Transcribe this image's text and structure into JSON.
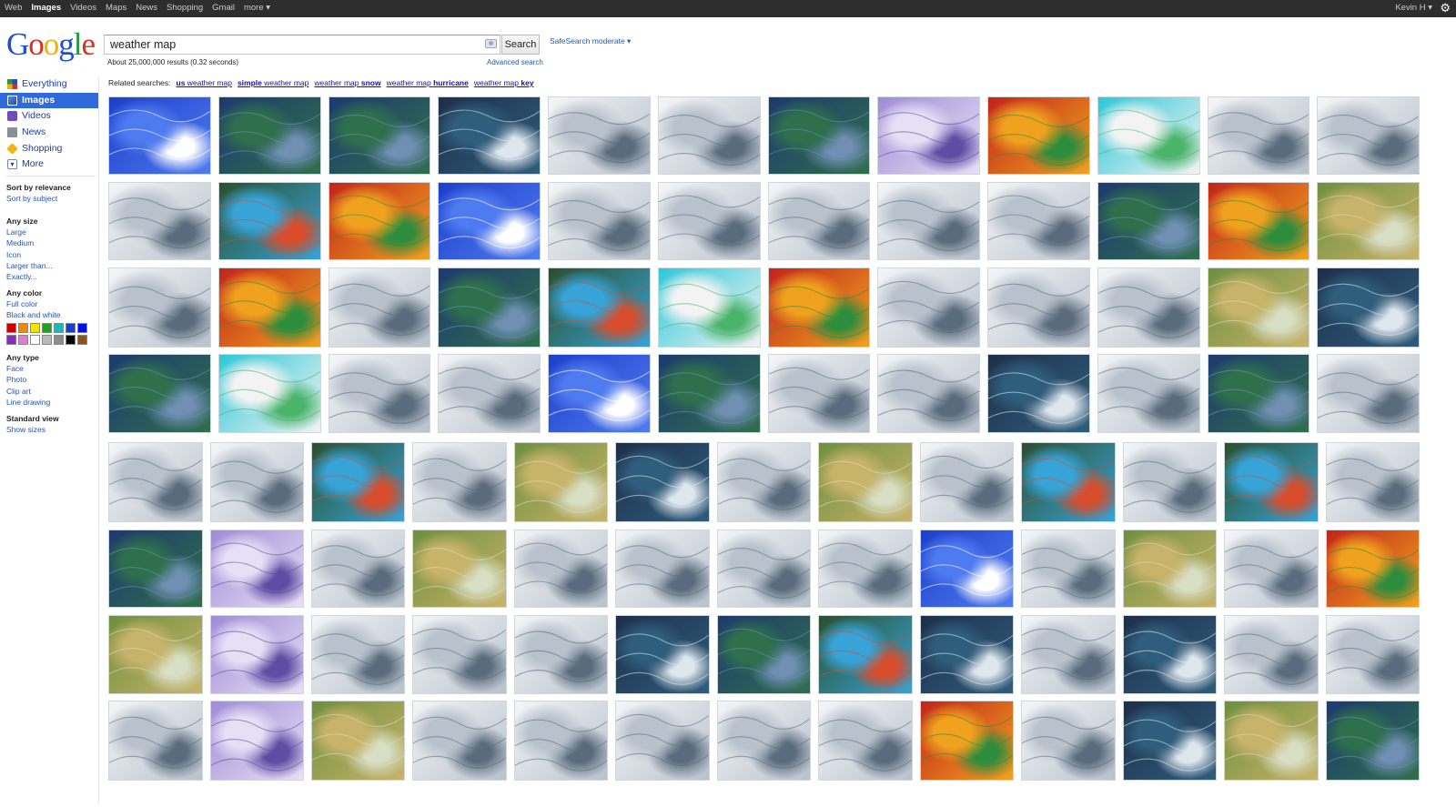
{
  "topbar": {
    "links": [
      {
        "label": "Web",
        "active": false
      },
      {
        "label": "Images",
        "active": true
      },
      {
        "label": "Videos",
        "active": false
      },
      {
        "label": "Maps",
        "active": false
      },
      {
        "label": "News",
        "active": false
      },
      {
        "label": "Shopping",
        "active": false
      },
      {
        "label": "Gmail",
        "active": false
      },
      {
        "label": "more ▾",
        "active": false
      }
    ],
    "user": "Kevin H ▾",
    "settings_icon": "gear-icon"
  },
  "logo": {
    "letters": [
      "G",
      "o",
      "o",
      "g",
      "l",
      "e"
    ]
  },
  "search": {
    "query": "weather map",
    "button_label": "Search",
    "safesearch": "SafeSearch moderate ▾",
    "results_stats": "About 25,000,000 results (0.32 seconds)",
    "advanced_search": "Advanced search"
  },
  "related": {
    "label": "Related searches:",
    "items": [
      {
        "prefix": "",
        "bold": "us",
        "suffix": " weather map"
      },
      {
        "prefix": "",
        "bold": "simple",
        "suffix": " weather map"
      },
      {
        "prefix": "weather map ",
        "bold": "snow",
        "suffix": ""
      },
      {
        "prefix": "weather map ",
        "bold": "hurricane",
        "suffix": ""
      },
      {
        "prefix": "weather map ",
        "bold": "key",
        "suffix": ""
      }
    ]
  },
  "sidebar": {
    "items": [
      {
        "label": "Everything",
        "icon": "everything-icon",
        "active": false
      },
      {
        "label": "Images",
        "icon": "images-icon",
        "active": true
      },
      {
        "label": "Videos",
        "icon": "videos-icon",
        "active": false
      },
      {
        "label": "News",
        "icon": "news-icon",
        "active": false
      },
      {
        "label": "Shopping",
        "icon": "shopping-icon",
        "active": false
      },
      {
        "label": "More",
        "icon": "more-chevron-icon",
        "active": false
      }
    ],
    "sort": {
      "head": "Sort by relevance",
      "opts": [
        "Sort by subject"
      ]
    },
    "size": {
      "head": "Any size",
      "opts": [
        "Large",
        "Medium",
        "Icon",
        "Larger than...",
        "Exactly..."
      ]
    },
    "color": {
      "head": "Any color",
      "opts": [
        "Full color",
        "Black and white"
      ]
    },
    "swatches": [
      "#cc0000",
      "#f08a00",
      "#f2e600",
      "#1fa11f",
      "#22b5b5",
      "#1a3ccf",
      "#0010d8",
      "#8a28c0",
      "#e877d8",
      "#ffffff",
      "#b8b8b8",
      "#8c8c8c",
      "#000000",
      "#8a5320"
    ],
    "type": {
      "head": "Any type",
      "opts": [
        "Face",
        "Photo",
        "Clip art",
        "Line drawing"
      ]
    },
    "view": {
      "head": "Standard view",
      "opts": [
        "Show sizes"
      ]
    }
  },
  "results": {
    "rows": [
      [
        "cartoon-weather-icons",
        "current-surface-map",
        "current-surface-map-dark",
        "satellite-composite-map",
        "sketch-front-map",
        "us-pressure-map",
        "noaa-front-map",
        "purple-contour-map",
        "current-temperatures-map",
        "colorful-station-map",
        "world-station-map",
        "australia-forecast-map"
      ],
      [
        "usda-weather-bureau-map",
        "national-doppler-radar",
        "current-temperatures-red",
        "blue-kids-weather-map",
        "front-analysis-map",
        "netservice-pressure-map",
        "dark-pressure-map",
        "hoboken-weather-map",
        "county-outline-map",
        "noaa-dark-surface-map",
        "heat-index-map",
        "green-terrain-map"
      ],
      [
        "station-plot-map",
        "europe-temperature-map",
        "europe-forecast-map",
        "surface-fronts-map",
        "hurricane-radar-map",
        "state-click-map",
        "texas-temperature-map",
        "blue-isobar-map",
        "line-front-sketch",
        "low-pressure-map",
        "terrain-relief-map",
        "cloud-satellite-map"
      ],
      [
        "current-surface-radar",
        "route-line-map",
        "beige-pressure-map",
        "station-model-map",
        "my-weather-map",
        "current-surface-blue",
        "imap-weather-screen",
        "isobar-sketch-map",
        "night-satellite-map",
        "colored-station-plot",
        "blue-fronts-map",
        "alaska-station-map"
      ],
      [
        "light-station-map",
        "florida-weather-chart",
        "snow-band-map",
        "old-chart-scan",
        "china-map",
        "satellite-fronts-map",
        "us-road-weather-map",
        "green-forecast-map",
        "beige-station-map",
        "southeast-radar-map",
        "australia-isobar-map",
        "precip-radar-map",
        "us-surface-analysis"
      ],
      [
        "current-surface-green",
        "pink-front-map",
        "north-america-fronts",
        "terrain-pressure-map",
        "gray-cloud-map",
        "weather-key-diagram",
        "gray-surface-map",
        "blue-surface-map",
        "cartoon-weatherman",
        "isobar-sheet",
        "australia-green-map",
        "isobar-white-map",
        "national-forecast-temperature"
      ],
      [
        "china-terrain-map",
        "purple-isobar-map",
        "snow-line-map",
        "ireland-today-map",
        "compass-diagram",
        "satellite-radar-map",
        "pressure-dark-map",
        "cyan-radar-map",
        "satellite-blue-map",
        "forecast-valid-map",
        "blue-marble-satellite",
        "symbol-sketch-map",
        "faded-surface-map"
      ],
      [
        "todays-forecast-screen",
        "contour-sheet-map",
        "green-terrain-outline",
        "station-grid-map",
        "high-low-arrows-map",
        "world-outline-map",
        "sketch-isobar-map",
        "web-page-map",
        "todays-forecast-heat",
        "pressure-legend-map",
        "south-america-satellite",
        "africa-terrain-map",
        "noaa-dark-green-map"
      ]
    ]
  }
}
